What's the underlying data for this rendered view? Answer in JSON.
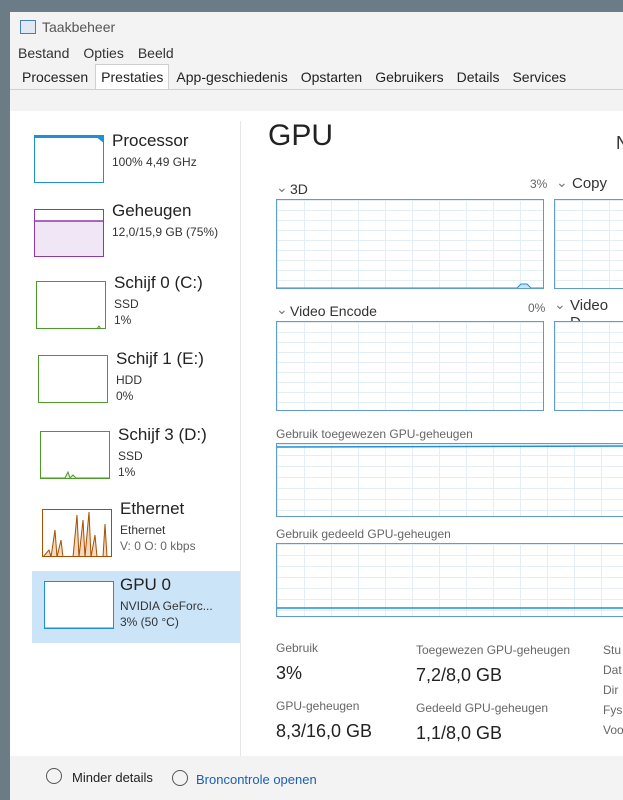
{
  "window": {
    "title": "Taakbeheer"
  },
  "menu": [
    "Bestand",
    "Opties",
    "Beeld"
  ],
  "tabs": [
    "Processen",
    "Prestaties",
    "App-geschiedenis",
    "Opstarten",
    "Gebruikers",
    "Details",
    "Services"
  ],
  "active_tab": "Prestaties",
  "sidebar": [
    {
      "title": "Processor",
      "line1": "100% 4,49 GHz",
      "line2": ""
    },
    {
      "title": "Geheugen",
      "line1": "12,0/15,9 GB (75%)",
      "line2": ""
    },
    {
      "title": "Schijf 0 (C:)",
      "line1": "SSD",
      "line2": "1%"
    },
    {
      "title": "Schijf 1 (E:)",
      "line1": "HDD",
      "line2": "0%"
    },
    {
      "title": "Schijf 3 (D:)",
      "line1": "SSD",
      "line2": "1%"
    },
    {
      "title": "Ethernet",
      "line1": "Ethernet",
      "line2": "V: 0 O: 0 kbps"
    },
    {
      "title": "GPU 0",
      "line1": "NVIDIA GeForc...",
      "line2": "3% (50 °C)"
    }
  ],
  "colors": {
    "cpu": "#1f8fd6",
    "memory": "#8b3aa8",
    "disk": "#4c9a2a",
    "ethernet": "#a74f01",
    "gpu": "#1f8fd6"
  },
  "main": {
    "title": "GPU",
    "title_right_fragment": "N",
    "engines": [
      {
        "name": "3D",
        "percent": "3%"
      },
      {
        "name": "Copy",
        "percent": ""
      },
      {
        "name": "Video Encode",
        "percent": "0%"
      },
      {
        "name": "Video D",
        "percent": ""
      }
    ],
    "dedicated_label": "Gebruik toegewezen GPU-geheugen",
    "shared_label": "Gebruik gedeeld GPU-geheugen",
    "stats": [
      {
        "label": "Gebruik",
        "value": "3%"
      },
      {
        "label": "Toegewezen GPU-geheugen",
        "value": "7,2/8,0 GB"
      },
      {
        "label": "GPU-geheugen",
        "value": "8,3/16,0 GB"
      },
      {
        "label": "Gedeeld GPU-geheugen",
        "value": "1,1/8,0 GB"
      }
    ],
    "side_labels": [
      "Stu",
      "Dat",
      "Dir",
      "Fys",
      "Voo"
    ]
  },
  "footer": {
    "less_details": "Minder details",
    "resource_monitor": "Broncontrole openen"
  }
}
